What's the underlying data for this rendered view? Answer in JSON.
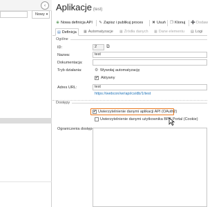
{
  "left_panel": {
    "new_button_label": "Nowy",
    "caret": "▾",
    "back_icon": "‹"
  },
  "header": {
    "title": "Aplikacje",
    "subtitle": "(test)"
  },
  "toolbar": {
    "new_api_def": "Nowa definicja API",
    "save_publish": "Zapisz i publikuj proces",
    "delete": "Usuń",
    "clone": "Klonuj",
    "delete_partial": "Dodaw"
  },
  "tabs": [
    {
      "label": "Definicja",
      "state": "active"
    },
    {
      "label": "Automatyzacje",
      "state": "normal"
    },
    {
      "label": "Źródła danych",
      "state": "disabled"
    },
    {
      "label": "Dane elementu",
      "state": "disabled"
    },
    {
      "label": "Logi",
      "state": "normal"
    }
  ],
  "general": {
    "section_title": "Ogólne",
    "id_label": "ID:",
    "id_value": "2",
    "name_label": "Nazwa:",
    "name_value": "test",
    "docs_label": "Dokumentacja:",
    "docs_value": "",
    "mode_label": "Tryb działania:",
    "mode_value": "Wywołaj automatyzację",
    "active_label": "Aktywny",
    "active_checked": true,
    "address_label": "Adres URL:",
    "address_value": "test",
    "address_link": "https://webcon/wr/api/cs/db/1/test"
  },
  "access": {
    "section_title": "Dostępy",
    "option1_label": "Uwierzytelnienie danymi aplikacji API (OAuth2)",
    "option1_checked": true,
    "option2_label": "Uwierzytelnienie danymi użytkownika BPS Portal (Cookie)",
    "option2_checked": false,
    "restrictions_label": "Ograniczenia dostępu:"
  },
  "colors": {
    "highlight": "#e8761c",
    "link": "#1a6fb5",
    "selected_row": "#dcdcdc"
  },
  "icons": {
    "check": "✔",
    "copy": "⧉",
    "gear": "⚙",
    "new_api": "⊕",
    "save": "✎",
    "delete": "✖",
    "clone": "❐",
    "add": "➕"
  }
}
